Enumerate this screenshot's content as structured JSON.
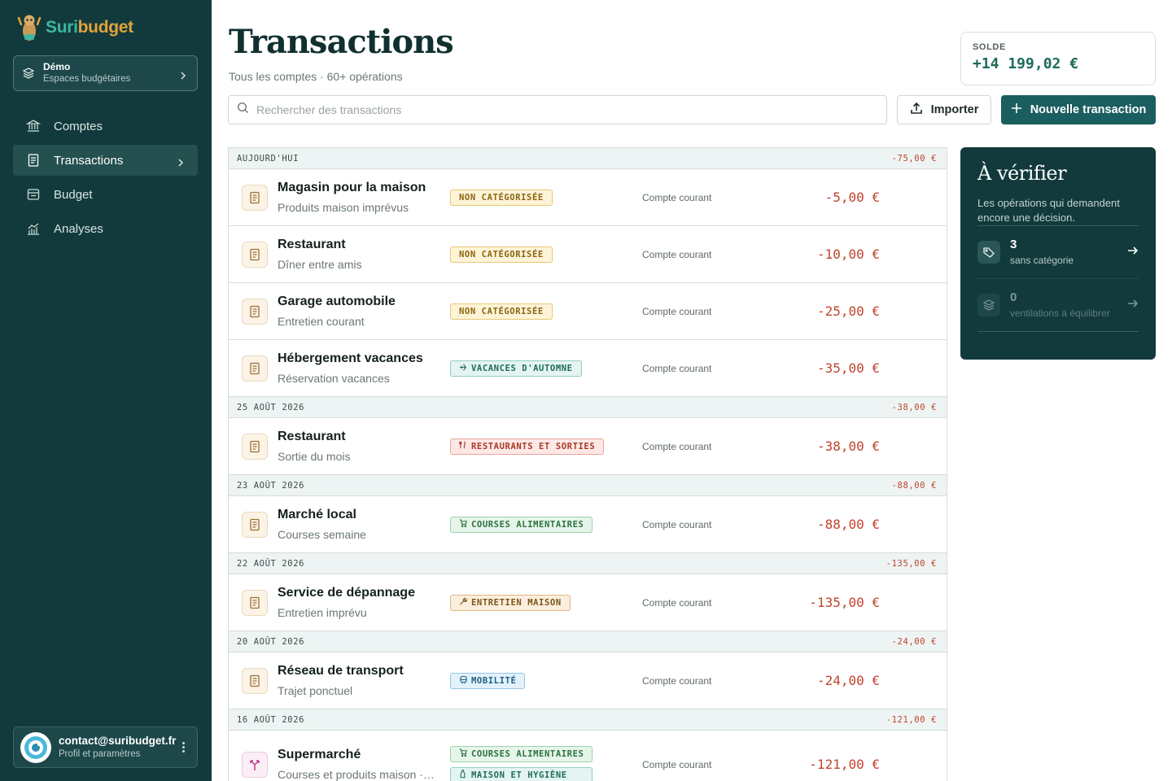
{
  "app": {
    "brand_a": "Suri",
    "brand_b": "budget",
    "accent": "#1b5e60",
    "sidebar_bg": "#123a3c",
    "negative_color": "#c0442e"
  },
  "workspace": {
    "name": "Démo",
    "sub": "Espaces budgétaires"
  },
  "nav": [
    {
      "label": "Comptes",
      "icon": "bank-icon",
      "active": false
    },
    {
      "label": "Transactions",
      "icon": "receipt-icon",
      "active": true
    },
    {
      "label": "Budget",
      "icon": "wallet-icon",
      "active": false
    },
    {
      "label": "Analyses",
      "icon": "chart-icon",
      "active": false
    }
  ],
  "profile": {
    "email": "contact@suribudget.fr",
    "sub": "Profil et paramètres"
  },
  "header": {
    "title": "Transactions",
    "subtitle": "Tous les comptes · 60+ opérations",
    "balance_label": "SOLDE",
    "balance_value": "+14 199,02 €"
  },
  "toolbar": {
    "search_placeholder": "Rechercher des transactions",
    "import_label": "Importer",
    "new_label": "Nouvelle transaction"
  },
  "groups": [
    {
      "date": "AUJOURD'HUI",
      "total": "-75,00 €",
      "rows": [
        {
          "title": "Magasin pour la maison",
          "sub": "Produits maison imprévus",
          "tags": [
            {
              "label": "NON CATÉGORISÉE",
              "kind": "uncat"
            }
          ],
          "account": "Compte courant",
          "amount": "-5,00 €"
        },
        {
          "title": "Restaurant",
          "sub": "Dîner entre amis",
          "tags": [
            {
              "label": "NON CATÉGORISÉE",
              "kind": "uncat"
            }
          ],
          "account": "Compte courant",
          "amount": "-10,00 €"
        },
        {
          "title": "Garage automobile",
          "sub": "Entretien courant",
          "tags": [
            {
              "label": "NON CATÉGORISÉE",
              "kind": "uncat"
            }
          ],
          "account": "Compte courant",
          "amount": "-25,00 €"
        },
        {
          "title": "Hébergement vacances",
          "sub": "Réservation vacances",
          "tags": [
            {
              "label": "VACANCES D'AUTOMNE",
              "kind": "travel"
            }
          ],
          "account": "Compte courant",
          "amount": "-35,00 €"
        }
      ]
    },
    {
      "date": "25 AOÛT 2026",
      "total": "-38,00 €",
      "rows": [
        {
          "title": "Restaurant",
          "sub": "Sortie du mois",
          "tags": [
            {
              "label": "RESTAURANTS ET SORTIES",
              "kind": "food"
            }
          ],
          "account": "Compte courant",
          "amount": "-38,00 €"
        }
      ]
    },
    {
      "date": "23 AOÛT 2026",
      "total": "-88,00 €",
      "rows": [
        {
          "title": "Marché local",
          "sub": "Courses semaine",
          "tags": [
            {
              "label": "COURSES ALIMENTAIRES",
              "kind": "grocery"
            }
          ],
          "account": "Compte courant",
          "amount": "-88,00 €"
        }
      ]
    },
    {
      "date": "22 AOÛT 2026",
      "total": "-135,00 €",
      "rows": [
        {
          "title": "Service de dépannage",
          "sub": "Entretien imprévu",
          "tags": [
            {
              "label": "ENTRETIEN MAISON",
              "kind": "repair"
            }
          ],
          "account": "Compte courant",
          "amount": "-135,00 €"
        }
      ]
    },
    {
      "date": "20 AOÛT 2026",
      "total": "-24,00 €",
      "rows": [
        {
          "title": "Réseau de transport",
          "sub": "Trajet ponctuel",
          "tags": [
            {
              "label": "MOBILITÉ",
              "kind": "transit"
            }
          ],
          "account": "Compte courant",
          "amount": "-24,00 €"
        }
      ]
    },
    {
      "date": "16 AOÛT 2026",
      "total": "-121,00 €",
      "rows": [
        {
          "title": "Supermarché",
          "sub": "Courses et produits maison · ventilé",
          "split": true,
          "tags": [
            {
              "label": "COURSES ALIMENTAIRES",
              "kind": "grocery"
            },
            {
              "label": "MAISON ET HYGIÈNE",
              "kind": "home"
            }
          ],
          "account": "Compte courant",
          "amount": "-121,00 €"
        }
      ]
    }
  ],
  "review": {
    "title": "À vérifier",
    "desc": "Les opérations qui demandent encore une décision.",
    "items": [
      {
        "count": "3",
        "label": "sans catégorie",
        "icon": "tag-icon",
        "dim": false
      },
      {
        "count": "0",
        "label": "ventilations à équilibrer",
        "icon": "layers-icon",
        "dim": true
      }
    ]
  }
}
